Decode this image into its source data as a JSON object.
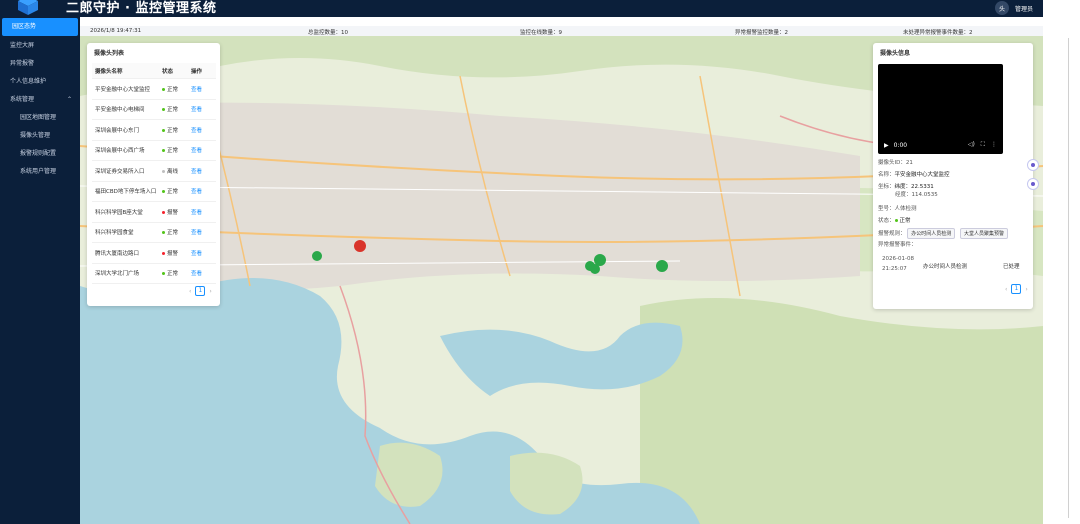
{
  "header": {
    "title": "二郎守护 · 监控管理系统",
    "user_avatar": "头",
    "user_label": "管理员"
  },
  "sidebar": {
    "items": [
      {
        "label": "园区态势",
        "active": true
      },
      {
        "label": "监控大屏"
      },
      {
        "label": "异常报警"
      },
      {
        "label": "个人信息维护"
      },
      {
        "label": "系统管理",
        "expanded": true
      },
      {
        "label": "园区地图管理",
        "sub": true
      },
      {
        "label": "摄像头管理",
        "sub": true
      },
      {
        "label": "报警规则配置",
        "sub": true
      },
      {
        "label": "系统用户管理",
        "sub": true
      }
    ]
  },
  "statusbar": {
    "datetime": "2026/1/8 19:47:31",
    "total": "总监控数量：10",
    "online": "监控在线数量：9",
    "alarm": "异常报警监控数量：2",
    "unhandled": "未处理异常报警事件数量：2"
  },
  "camera_list": {
    "title": "摄像头列表",
    "columns": [
      "摄像头名称",
      "状态",
      "操作"
    ],
    "rows": [
      {
        "name": "平安金融中心大堂监控",
        "status": "正常",
        "op": "查看"
      },
      {
        "name": "平安金融中心电梯间",
        "status": "正常",
        "op": "查看"
      },
      {
        "name": "深圳会展中心东门",
        "status": "正常",
        "op": "查看"
      },
      {
        "name": "深圳会展中心西广场",
        "status": "正常",
        "op": "查看"
      },
      {
        "name": "深圳证券交易所入口",
        "status": "离线",
        "op": "查看"
      },
      {
        "name": "福田CBD地下停车场入口",
        "status": "正常",
        "op": "查看"
      },
      {
        "name": "科兴科学园B座大堂",
        "status": "报警",
        "op": "查看"
      },
      {
        "name": "科兴科学园食堂",
        "status": "正常",
        "op": "查看"
      },
      {
        "name": "腾讯大厦南边路口",
        "status": "报警",
        "op": "查看"
      },
      {
        "name": "深圳大学北门广场",
        "status": "正常",
        "op": "查看"
      }
    ],
    "page": "1",
    "prev": "‹",
    "next": "›"
  },
  "camera_info": {
    "title": "摄像头信息",
    "video_time": "0:00",
    "id": "摄像头ID：21",
    "name_label": "名称：",
    "name": "平安金融中心大堂监控",
    "coord_label": "坐标：",
    "lat": "纬度：22.5331",
    "lng": "经度：114.0535",
    "model": "型号：人体检测",
    "state_label": "状态：",
    "state": "正常",
    "rules_label": "报警规则：",
    "rules": [
      "办公时间人员检测",
      "大堂人员聚集预警"
    ],
    "events_label": "异常报警事件：",
    "event_date": "2026-01-08",
    "event_time": "21:25:07",
    "event_type": "办公时间人员检测",
    "event_state": "已处理",
    "page": "1",
    "prev": "‹",
    "next": "›"
  },
  "colors": {
    "sidebar_bg": "#0b1f3a",
    "accent": "#1890ff",
    "normal": "#52c41a",
    "offline": "#bfbfbf",
    "alarm": "#f5222d",
    "water": "#aad3df",
    "land": "#e8ecd9"
  },
  "icons": [
    "logo-cube-icon",
    "camera-marker-icon",
    "alarm-marker-icon",
    "play-icon",
    "volume-icon",
    "fullscreen-icon",
    "more-icon"
  ]
}
